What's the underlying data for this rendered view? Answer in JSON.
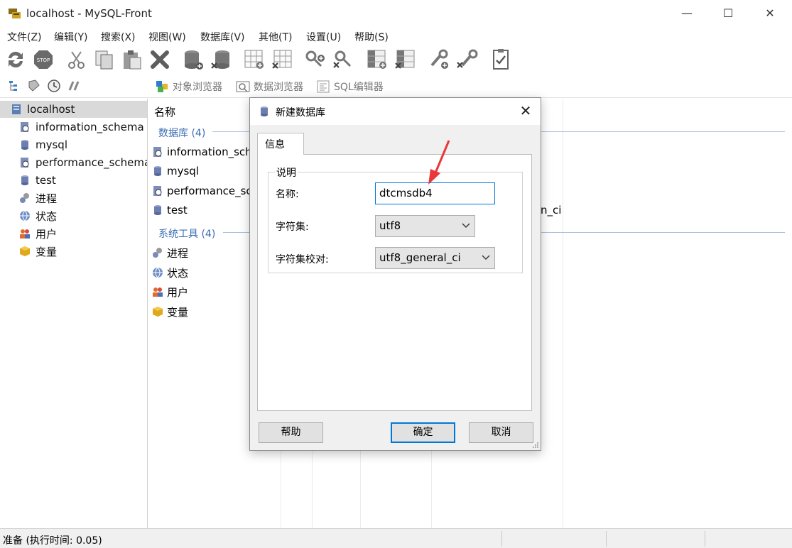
{
  "window": {
    "title": "localhost - MySQL-Front"
  },
  "menu": [
    "文件(Z)",
    "编辑(Y)",
    "搜索(X)",
    "视图(W)",
    "数据库(V)",
    "其他(T)",
    "设置(U)",
    "帮助(S)"
  ],
  "toolbar": {
    "icons": [
      "refresh-icon",
      "stop-icon",
      "cut-icon",
      "copy-icon",
      "paste-icon",
      "delete-icon",
      "add-database-icon",
      "remove-database-icon",
      "add-table-icon",
      "remove-table-icon",
      "add-user-icon",
      "remove-user-icon",
      "add-field-icon",
      "remove-field-icon",
      "add-key-icon",
      "remove-key-icon",
      "properties-icon"
    ]
  },
  "toolbar2": {
    "object_browser": "对象浏览器",
    "data_browser": "数据浏览器",
    "sql_editor": "SQL编辑器"
  },
  "tree": [
    {
      "label": "localhost",
      "icon": "server-icon"
    },
    {
      "label": "information_schema",
      "icon": "system-database-icon"
    },
    {
      "label": "mysql",
      "icon": "database-icon"
    },
    {
      "label": "performance_schema",
      "icon": "system-database-icon"
    },
    {
      "label": "test",
      "icon": "database-icon"
    },
    {
      "label": "进程",
      "icon": "processes-icon"
    },
    {
      "label": "状态",
      "icon": "status-globe-icon"
    },
    {
      "label": "用户",
      "icon": "users-icon"
    },
    {
      "label": "变量",
      "icon": "variables-box-icon"
    }
  ],
  "content": {
    "column_header": "名称",
    "groups": [
      {
        "label": "数据库 (4)",
        "items": [
          "information_schema",
          "mysql",
          "performance_schema",
          "test"
        ]
      },
      {
        "label": "系统工具 (4)",
        "items": [
          "进程",
          "状态",
          "用户",
          "变量"
        ]
      }
    ],
    "partial_collation_text": "n_ci"
  },
  "dialog": {
    "title": "新建数据库",
    "tab": "信息",
    "group_label": "说明",
    "name_label": "名称:",
    "name_value": "dtcmsdb4",
    "charset_label": "字符集:",
    "charset_value": "utf8",
    "collation_label": "字符集校对:",
    "collation_value": "utf8_general_ci",
    "help_button": "帮助",
    "ok_button": "确定",
    "cancel_button": "取消"
  },
  "status": {
    "text": "准备  (执行时间: 0.05)"
  },
  "colors": {
    "selection": "#d9d9d9",
    "group_label": "#3b6db3",
    "accent": "#0078d7",
    "annotation_arrow": "#e8383a"
  }
}
